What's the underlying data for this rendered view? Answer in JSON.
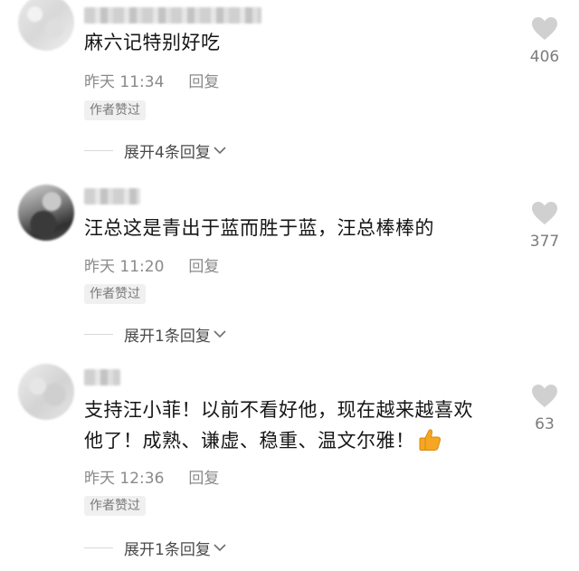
{
  "comments": [
    {
      "text": "麻六记特别好吃",
      "time": "昨天 11:34",
      "reply_label": "回复",
      "author_badge": "作者赞过",
      "expand_label": "展开4条回复",
      "likes": "406",
      "avatar_style": "light"
    },
    {
      "text": "汪总这是青出于蓝而胜于蓝，汪总棒棒的",
      "time": "昨天 11:20",
      "reply_label": "回复",
      "author_badge": "作者赞过",
      "expand_label": "展开1条回复",
      "likes": "377",
      "avatar_style": "dark"
    },
    {
      "text_line1": "支持汪小菲！以前不看好他，现在越来越喜欢",
      "text_line2": "他了！成熟、谦虚、稳重、温文尔雅！",
      "emoji": "thumbs-up",
      "time": "昨天 12:36",
      "reply_label": "回复",
      "author_badge": "作者赞过",
      "expand_label": "展开1条回复",
      "likes": "63",
      "avatar_style": "gray"
    }
  ],
  "colors": {
    "text": "#161616",
    "meta": "#8a8a8a",
    "badge_bg": "#f0f0f0",
    "like_icon": "#d0d0d0",
    "emoji": "#f5a623"
  }
}
